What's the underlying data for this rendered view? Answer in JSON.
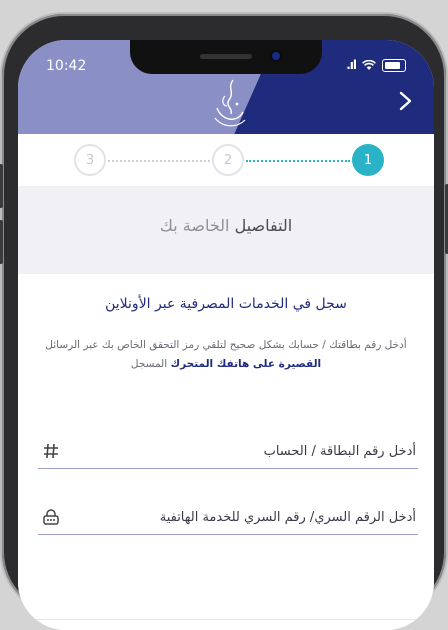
{
  "status_bar": {
    "time": "10:42",
    "signal": ".ıl"
  },
  "header": {
    "back_icon": "chevron-right-icon",
    "logo_icon": "calligraphy-logo-icon"
  },
  "stepper": {
    "steps": [
      "3",
      "2",
      "1"
    ],
    "active_step": "1"
  },
  "section": {
    "title_part1": "التفاصيل",
    "title_part2": "الخاصة بك"
  },
  "form": {
    "heading": "سجل في الخدمات المصرفية عبر الأونلاين",
    "instruction_part1": "أدخل رقم بطاقتك / حسابك بشكل صحيح لتلقي رمز التحقق الخاص بك عبر الرسائل",
    "instruction_part2": "القصيرة على هاتفك المتحرك",
    "instruction_part3": "المسجل",
    "card_field_label": "أدخل رقم البطاقة / الحساب",
    "card_field_icon": "hash-icon",
    "pin_field_label": "أدخل الرقم السري/ رقم السري للخدمة الهاتفية",
    "pin_field_icon": "keypad-lock-icon"
  },
  "colors": {
    "accent": "#2ab3c6",
    "navy": "#1f2b7d",
    "lavender": "#8a8fc6"
  }
}
